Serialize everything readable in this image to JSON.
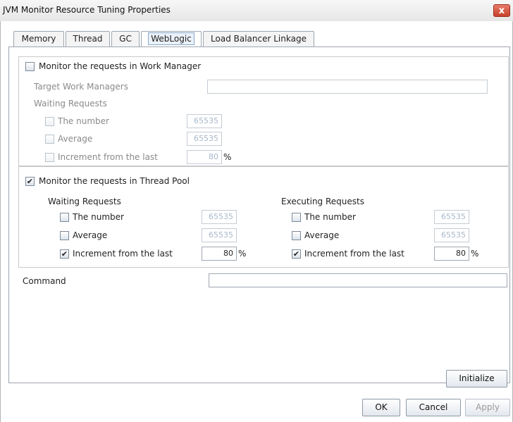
{
  "window": {
    "title": "JVM Monitor Resource Tuning Properties",
    "close_glyph": "x"
  },
  "tabs": [
    {
      "label": "Memory"
    },
    {
      "label": "Thread"
    },
    {
      "label": "GC"
    },
    {
      "label": "WebLogic"
    },
    {
      "label": "Load Balancer Linkage"
    }
  ],
  "work_manager": {
    "checkbox_label": "Monitor the requests in Work Manager",
    "checked": false,
    "target_label": "Target Work Managers",
    "target_value": "",
    "waiting_label": "Waiting Requests",
    "number_label": "The number",
    "number_value": "65535",
    "average_label": "Average",
    "average_value": "65535",
    "increment_label": "Increment from the last",
    "increment_value": "80",
    "percent": "%"
  },
  "thread_pool": {
    "checkbox_label": "Monitor the requests in Thread Pool",
    "checked": true,
    "waiting": {
      "label": "Waiting Requests",
      "number_label": "The number",
      "number_value": "65535",
      "number_checked": false,
      "average_label": "Average",
      "average_value": "65535",
      "average_checked": false,
      "increment_label": "Increment from the last",
      "increment_value": "80",
      "increment_checked": true,
      "percent": "%"
    },
    "executing": {
      "label": "Executing Requests",
      "number_label": "The number",
      "number_value": "65535",
      "number_checked": false,
      "average_label": "Average",
      "average_value": "65535",
      "average_checked": false,
      "increment_label": "Increment from the last",
      "increment_value": "80",
      "increment_checked": true,
      "percent": "%"
    }
  },
  "command": {
    "label": "Command",
    "value": ""
  },
  "buttons": {
    "initialize": "Initialize",
    "ok": "OK",
    "cancel": "Cancel",
    "apply": "Apply"
  },
  "check_glyph": "✔"
}
